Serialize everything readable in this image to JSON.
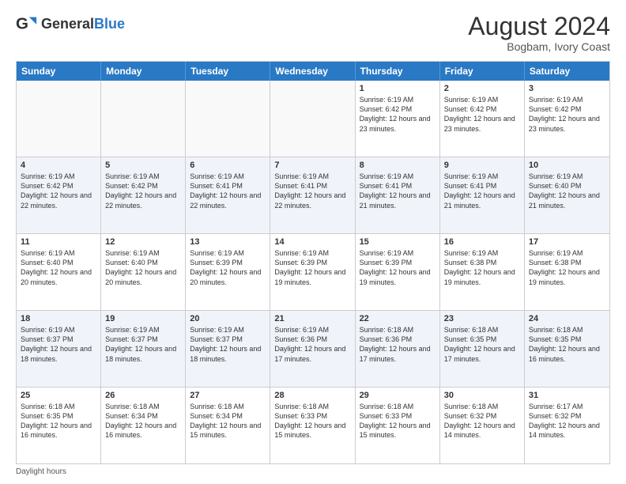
{
  "logo": {
    "general": "General",
    "blue": "Blue"
  },
  "title": {
    "month_year": "August 2024",
    "location": "Bogbam, Ivory Coast"
  },
  "days_of_week": [
    "Sunday",
    "Monday",
    "Tuesday",
    "Wednesday",
    "Thursday",
    "Friday",
    "Saturday"
  ],
  "footer": {
    "daylight_label": "Daylight hours"
  },
  "weeks": [
    [
      {
        "day": "",
        "content": ""
      },
      {
        "day": "",
        "content": ""
      },
      {
        "day": "",
        "content": ""
      },
      {
        "day": "",
        "content": ""
      },
      {
        "day": "1",
        "content": "Sunrise: 6:19 AM\nSunset: 6:42 PM\nDaylight: 12 hours and 23 minutes."
      },
      {
        "day": "2",
        "content": "Sunrise: 6:19 AM\nSunset: 6:42 PM\nDaylight: 12 hours and 23 minutes."
      },
      {
        "day": "3",
        "content": "Sunrise: 6:19 AM\nSunset: 6:42 PM\nDaylight: 12 hours and 23 minutes."
      }
    ],
    [
      {
        "day": "4",
        "content": "Sunrise: 6:19 AM\nSunset: 6:42 PM\nDaylight: 12 hours and 22 minutes."
      },
      {
        "day": "5",
        "content": "Sunrise: 6:19 AM\nSunset: 6:42 PM\nDaylight: 12 hours and 22 minutes."
      },
      {
        "day": "6",
        "content": "Sunrise: 6:19 AM\nSunset: 6:41 PM\nDaylight: 12 hours and 22 minutes."
      },
      {
        "day": "7",
        "content": "Sunrise: 6:19 AM\nSunset: 6:41 PM\nDaylight: 12 hours and 22 minutes."
      },
      {
        "day": "8",
        "content": "Sunrise: 6:19 AM\nSunset: 6:41 PM\nDaylight: 12 hours and 21 minutes."
      },
      {
        "day": "9",
        "content": "Sunrise: 6:19 AM\nSunset: 6:41 PM\nDaylight: 12 hours and 21 minutes."
      },
      {
        "day": "10",
        "content": "Sunrise: 6:19 AM\nSunset: 6:40 PM\nDaylight: 12 hours and 21 minutes."
      }
    ],
    [
      {
        "day": "11",
        "content": "Sunrise: 6:19 AM\nSunset: 6:40 PM\nDaylight: 12 hours and 20 minutes."
      },
      {
        "day": "12",
        "content": "Sunrise: 6:19 AM\nSunset: 6:40 PM\nDaylight: 12 hours and 20 minutes."
      },
      {
        "day": "13",
        "content": "Sunrise: 6:19 AM\nSunset: 6:39 PM\nDaylight: 12 hours and 20 minutes."
      },
      {
        "day": "14",
        "content": "Sunrise: 6:19 AM\nSunset: 6:39 PM\nDaylight: 12 hours and 19 minutes."
      },
      {
        "day": "15",
        "content": "Sunrise: 6:19 AM\nSunset: 6:39 PM\nDaylight: 12 hours and 19 minutes."
      },
      {
        "day": "16",
        "content": "Sunrise: 6:19 AM\nSunset: 6:38 PM\nDaylight: 12 hours and 19 minutes."
      },
      {
        "day": "17",
        "content": "Sunrise: 6:19 AM\nSunset: 6:38 PM\nDaylight: 12 hours and 19 minutes."
      }
    ],
    [
      {
        "day": "18",
        "content": "Sunrise: 6:19 AM\nSunset: 6:37 PM\nDaylight: 12 hours and 18 minutes."
      },
      {
        "day": "19",
        "content": "Sunrise: 6:19 AM\nSunset: 6:37 PM\nDaylight: 12 hours and 18 minutes."
      },
      {
        "day": "20",
        "content": "Sunrise: 6:19 AM\nSunset: 6:37 PM\nDaylight: 12 hours and 18 minutes."
      },
      {
        "day": "21",
        "content": "Sunrise: 6:19 AM\nSunset: 6:36 PM\nDaylight: 12 hours and 17 minutes."
      },
      {
        "day": "22",
        "content": "Sunrise: 6:18 AM\nSunset: 6:36 PM\nDaylight: 12 hours and 17 minutes."
      },
      {
        "day": "23",
        "content": "Sunrise: 6:18 AM\nSunset: 6:35 PM\nDaylight: 12 hours and 17 minutes."
      },
      {
        "day": "24",
        "content": "Sunrise: 6:18 AM\nSunset: 6:35 PM\nDaylight: 12 hours and 16 minutes."
      }
    ],
    [
      {
        "day": "25",
        "content": "Sunrise: 6:18 AM\nSunset: 6:35 PM\nDaylight: 12 hours and 16 minutes."
      },
      {
        "day": "26",
        "content": "Sunrise: 6:18 AM\nSunset: 6:34 PM\nDaylight: 12 hours and 16 minutes."
      },
      {
        "day": "27",
        "content": "Sunrise: 6:18 AM\nSunset: 6:34 PM\nDaylight: 12 hours and 15 minutes."
      },
      {
        "day": "28",
        "content": "Sunrise: 6:18 AM\nSunset: 6:33 PM\nDaylight: 12 hours and 15 minutes."
      },
      {
        "day": "29",
        "content": "Sunrise: 6:18 AM\nSunset: 6:33 PM\nDaylight: 12 hours and 15 minutes."
      },
      {
        "day": "30",
        "content": "Sunrise: 6:18 AM\nSunset: 6:32 PM\nDaylight: 12 hours and 14 minutes."
      },
      {
        "day": "31",
        "content": "Sunrise: 6:17 AM\nSunset: 6:32 PM\nDaylight: 12 hours and 14 minutes."
      }
    ]
  ]
}
